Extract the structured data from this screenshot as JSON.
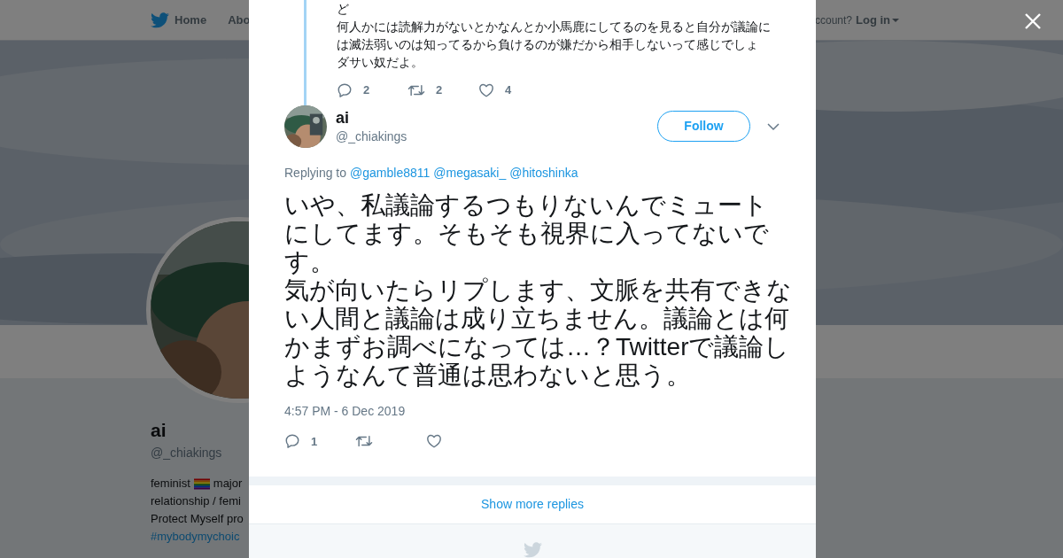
{
  "background_page": {
    "nav": {
      "items": [
        "Home",
        "Abo"
      ],
      "account_prompt": "ccount?",
      "login": "Log in"
    },
    "profile": {
      "name": "ai",
      "handle": "@_chiakings",
      "bio_first_before": "feminist",
      "bio_first_after": "major",
      "bio_lines": [
        "relationship / femi",
        "Protect Myself pro"
      ],
      "hashtag": "#mybodymychoic"
    }
  },
  "modal": {
    "quoted_tail": {
      "lines": [
        "ど",
        "何人かには読解力がないとかなんとか小馬鹿にしてるのを見ると自分が議論に",
        "は滅法弱いのは知ってるから負けるのが嫌だから相手しないって感じでしょ",
        "ダサい奴だよ。"
      ],
      "actions": [
        {
          "kind": "reply",
          "count": "2"
        },
        {
          "kind": "retweet",
          "count": "2"
        },
        {
          "kind": "like",
          "count": "4"
        }
      ]
    },
    "tweet": {
      "name": "ai",
      "handle": "@_chiakings",
      "follow": "Follow",
      "replying_label": "Replying to",
      "replying_to": [
        "@gamble8811",
        "@megasaki_",
        "@hitoshinka"
      ],
      "text": [
        "いや、私議論するつもりないんでミュート",
        "にしてます。そもそも視界に入ってないで",
        "す。",
        "気が向いたらリプします、文脈を共有できな",
        "い人間と議論は成り立ちません。議論とは何",
        "かまずお調べになっては…？Twitterで議論し",
        "ようなんて普通は思わないと思う。"
      ],
      "timestamp": "4:57 PM - 6 Dec 2019",
      "actions": [
        {
          "kind": "reply",
          "count": "1"
        },
        {
          "kind": "retweet"
        },
        {
          "kind": "like"
        }
      ]
    },
    "show_more": "Show more replies"
  }
}
